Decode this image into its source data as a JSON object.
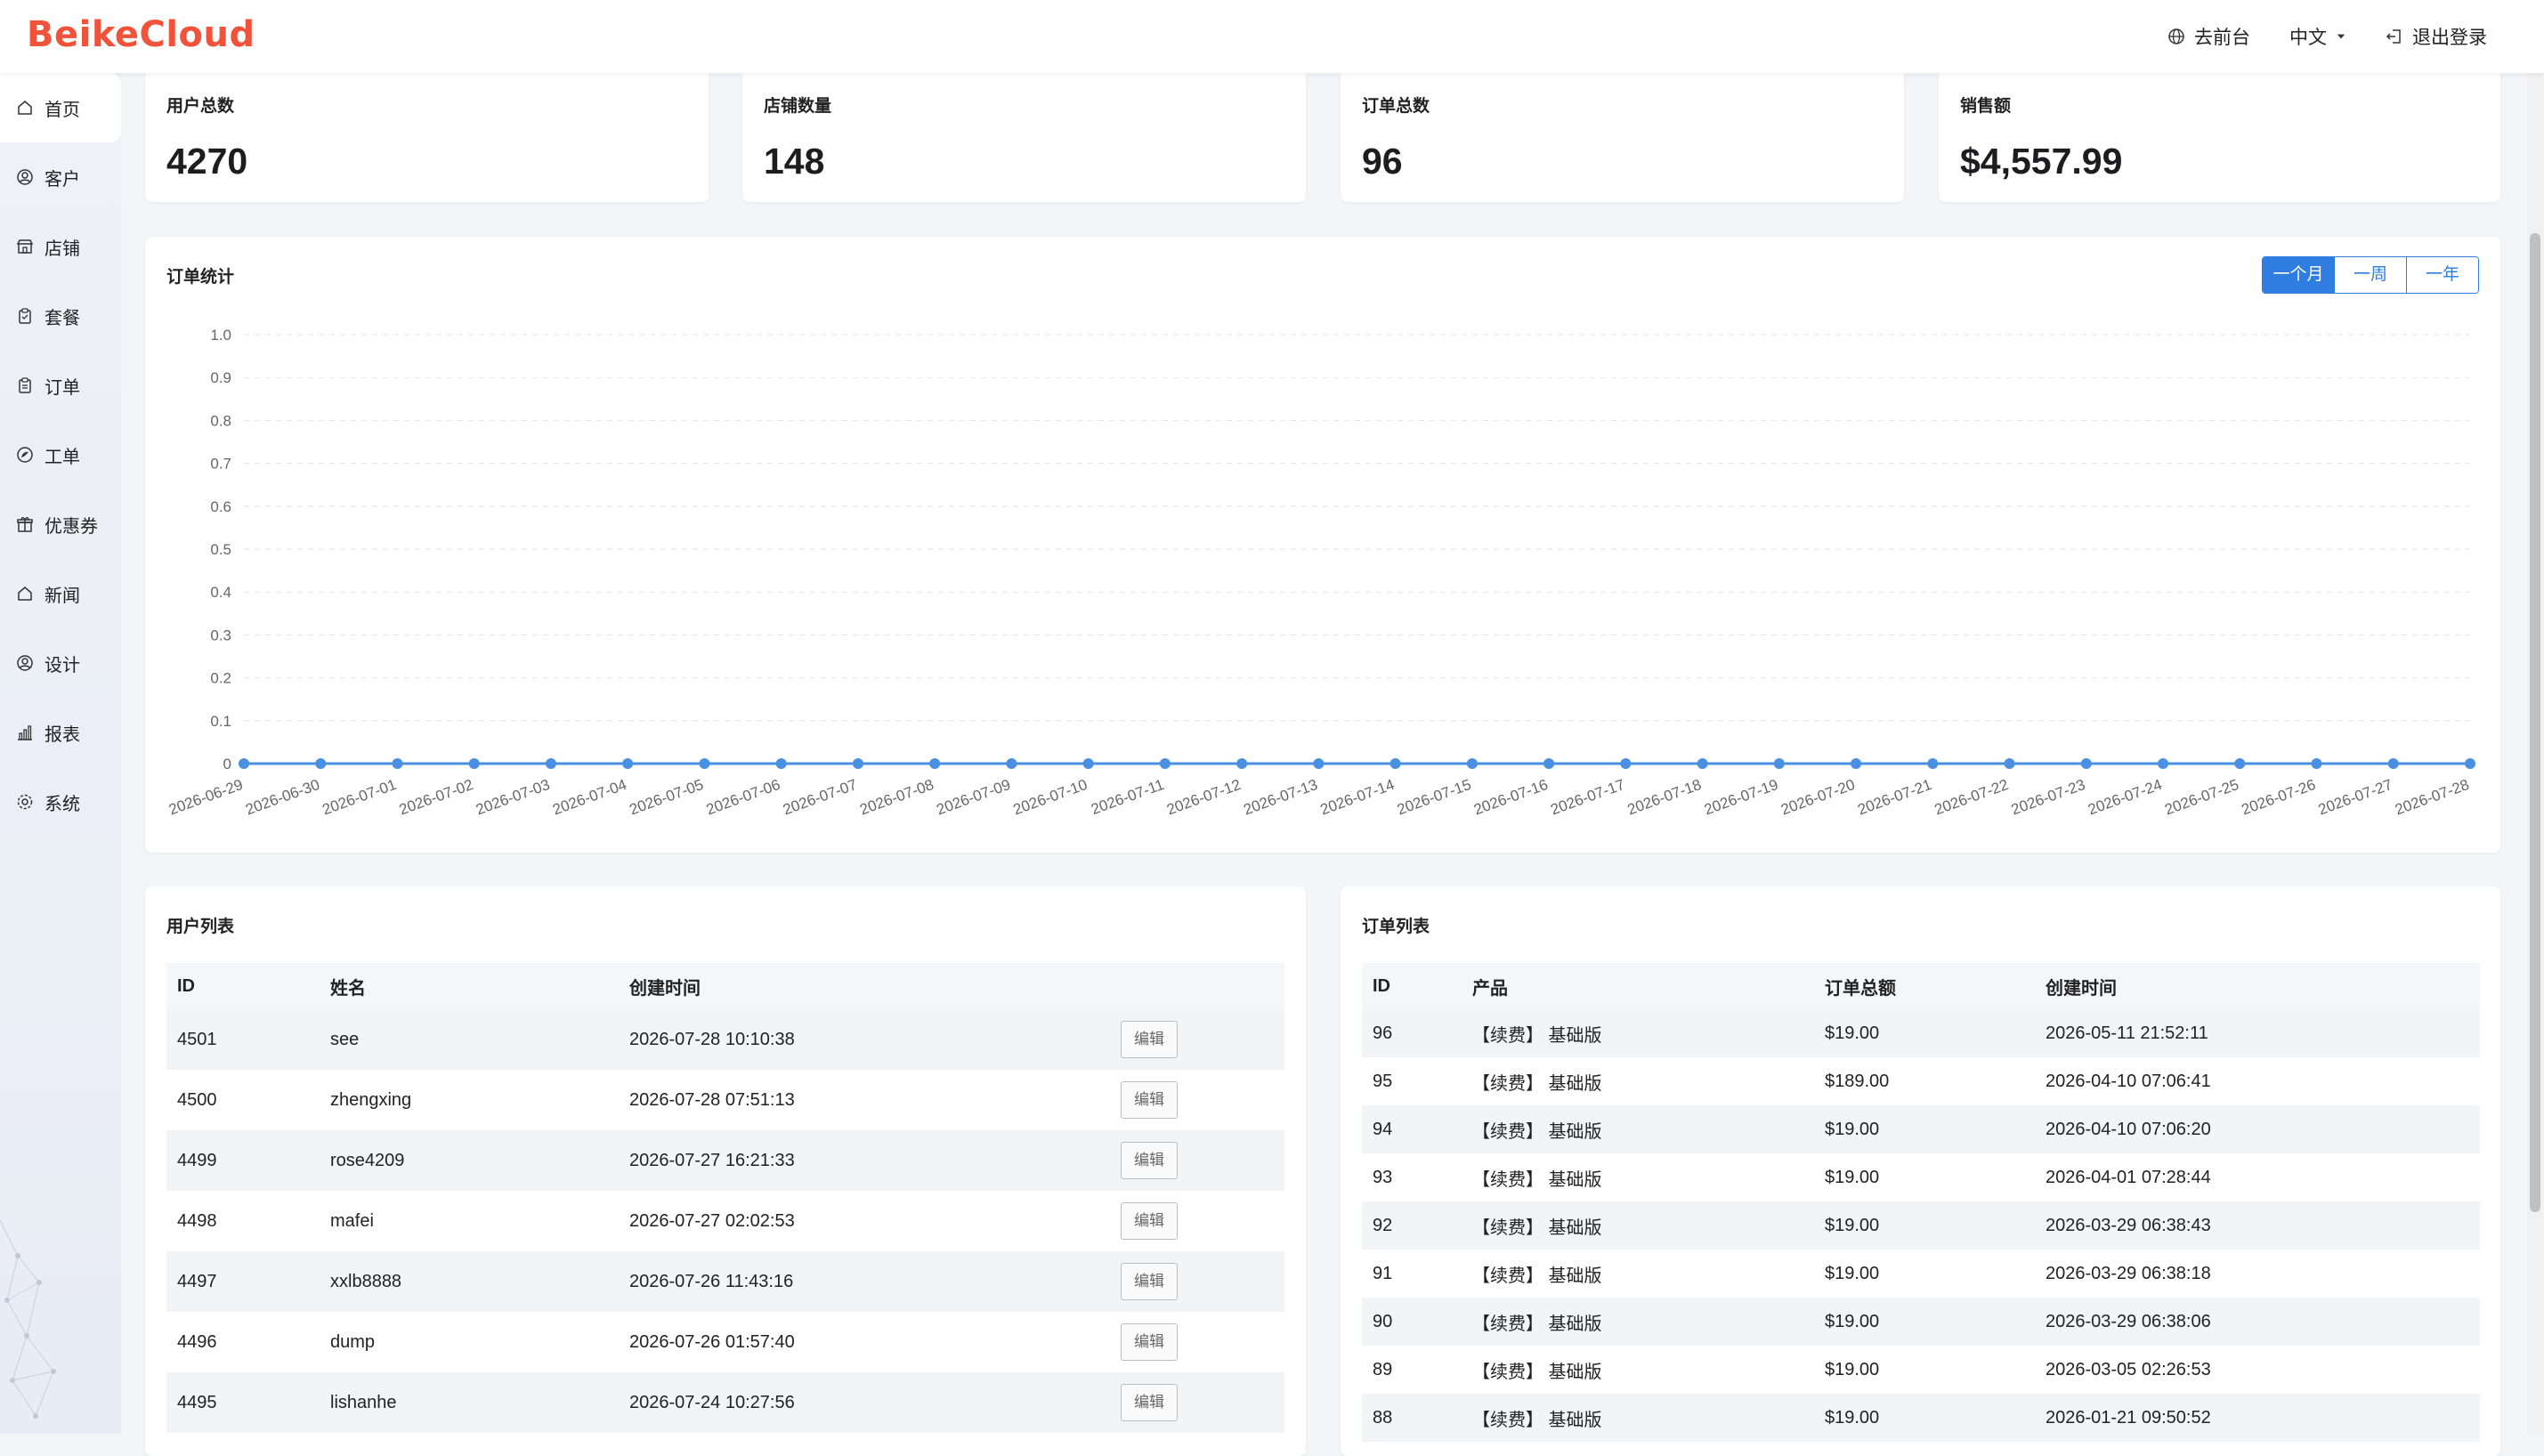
{
  "header": {
    "logo": "BeikeCloud",
    "actions": [
      "去前台",
      "中文",
      "退出登录"
    ],
    "colors": {
      "logo": "#f0523a",
      "accent": "#2f7de1"
    }
  },
  "sidebar": {
    "items": [
      {
        "label": "首页",
        "icon": "home-icon",
        "active": true
      },
      {
        "label": "客户",
        "icon": "user-circle-icon"
      },
      {
        "label": "店铺",
        "icon": "store-icon"
      },
      {
        "label": "套餐",
        "icon": "clipboard-icon"
      },
      {
        "label": "订单",
        "icon": "order-icon"
      },
      {
        "label": "工单",
        "icon": "ticket-icon"
      },
      {
        "label": "优惠券",
        "icon": "gift-icon"
      },
      {
        "label": "新闻",
        "icon": "news-icon"
      },
      {
        "label": "设计",
        "icon": "design-icon"
      },
      {
        "label": "报表",
        "icon": "bar-chart-icon"
      },
      {
        "label": "系统",
        "icon": "gear-icon"
      }
    ]
  },
  "stats": [
    {
      "label": "用户总数",
      "value": "4270"
    },
    {
      "label": "店铺数量",
      "value": "148"
    },
    {
      "label": "订单总数",
      "value": "96"
    },
    {
      "label": "销售额",
      "value": "$4,557.99"
    }
  ],
  "order_chart": {
    "title": "订单统计",
    "ranges": [
      "一个月",
      "一周",
      "一年"
    ],
    "active_range": "一个月"
  },
  "chart_data": {
    "type": "line",
    "x": [
      "2026-06-29",
      "2026-06-30",
      "2026-07-01",
      "2026-07-02",
      "2026-07-03",
      "2026-07-04",
      "2026-07-05",
      "2026-07-06",
      "2026-07-07",
      "2026-07-08",
      "2026-07-09",
      "2026-07-10",
      "2026-07-11",
      "2026-07-12",
      "2026-07-13",
      "2026-07-14",
      "2026-07-15",
      "2026-07-16",
      "2026-07-17",
      "2026-07-18",
      "2026-07-19",
      "2026-07-20",
      "2026-07-21",
      "2026-07-22",
      "2026-07-23",
      "2026-07-24",
      "2026-07-25",
      "2026-07-26",
      "2026-07-27",
      "2026-07-28"
    ],
    "series": [
      {
        "values": [
          0,
          0,
          0,
          0,
          0,
          0,
          0,
          0,
          0,
          0,
          0,
          0,
          0,
          0,
          0,
          0,
          0,
          0,
          0,
          0,
          0,
          0,
          0,
          0,
          0,
          0,
          0,
          0,
          0,
          0
        ]
      }
    ],
    "yticks": [
      "0",
      "0.1",
      "0.2",
      "0.3",
      "0.4",
      "0.5",
      "0.6",
      "0.7",
      "0.8",
      "0.9",
      "1.0"
    ],
    "ylim": [
      0,
      1
    ],
    "grid": true,
    "color": "#4a90e2"
  },
  "user_list": {
    "title": "用户列表",
    "columns": [
      "ID",
      "姓名",
      "创建时间",
      ""
    ],
    "edit_label": "编辑",
    "rows": [
      {
        "id": "4501",
        "name": "see",
        "created": "2026-07-28 10:10:38"
      },
      {
        "id": "4500",
        "name": "zhengxing",
        "created": "2026-07-28 07:51:13"
      },
      {
        "id": "4499",
        "name": "rose4209",
        "created": "2026-07-27 16:21:33"
      },
      {
        "id": "4498",
        "name": "mafei",
        "created": "2026-07-27 02:02:53"
      },
      {
        "id": "4497",
        "name": "xxlb8888",
        "created": "2026-07-26 11:43:16"
      },
      {
        "id": "4496",
        "name": "dump",
        "created": "2026-07-26 01:57:40"
      },
      {
        "id": "4495",
        "name": "lishanhe",
        "created": "2026-07-24 10:27:56"
      }
    ]
  },
  "order_list": {
    "title": "订单列表",
    "columns": [
      "ID",
      "产品",
      "订单总额",
      "创建时间"
    ],
    "rows": [
      {
        "id": "96",
        "product": "【续费】 基础版",
        "total": "$19.00",
        "created": "2026-05-11 21:52:11"
      },
      {
        "id": "95",
        "product": "【续费】 基础版",
        "total": "$189.00",
        "created": "2026-04-10 07:06:41"
      },
      {
        "id": "94",
        "product": "【续费】 基础版",
        "total": "$19.00",
        "created": "2026-04-10 07:06:20"
      },
      {
        "id": "93",
        "product": "【续费】 基础版",
        "total": "$19.00",
        "created": "2026-04-01 07:28:44"
      },
      {
        "id": "92",
        "product": "【续费】 基础版",
        "total": "$19.00",
        "created": "2026-03-29 06:38:43"
      },
      {
        "id": "91",
        "product": "【续费】 基础版",
        "total": "$19.00",
        "created": "2026-03-29 06:38:18"
      },
      {
        "id": "90",
        "product": "【续费】 基础版",
        "total": "$19.00",
        "created": "2026-03-29 06:38:06"
      },
      {
        "id": "89",
        "product": "【续费】 基础版",
        "total": "$19.00",
        "created": "2026-03-05 02:26:53"
      },
      {
        "id": "88",
        "product": "【续费】 基础版",
        "total": "$19.00",
        "created": "2026-01-21 09:50:52"
      }
    ]
  }
}
